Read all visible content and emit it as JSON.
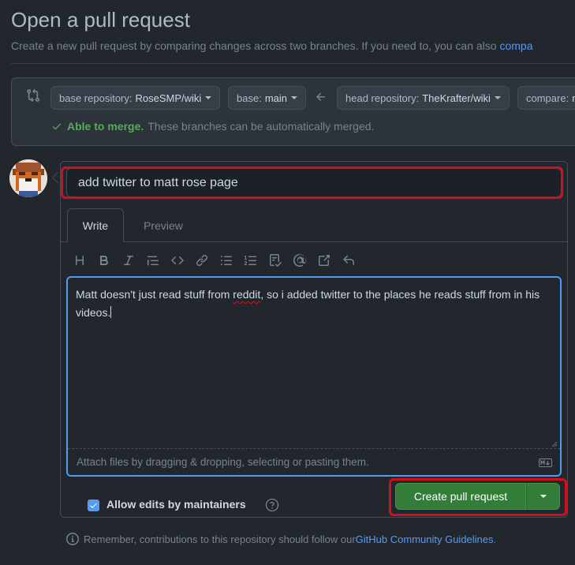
{
  "header": {
    "title": "Open a pull request",
    "subtitle_text": "Create a new pull request by comparing changes across two branches. If you need to, you can also ",
    "subtitle_link": "compa"
  },
  "range": {
    "base_repo_label": "base repository:",
    "base_repo_value": "RoseSMP/wiki",
    "base_label": "base:",
    "base_value": "main",
    "head_repo_label": "head repository:",
    "head_repo_value": "TheKrafter/wiki",
    "compare_label": "compare:",
    "compare_value": "m",
    "merge_status_bold": "Able to merge.",
    "merge_status_text": "These branches can be automatically merged."
  },
  "form": {
    "title_value": "add twitter to matt rose page",
    "tabs": [
      {
        "label": "Write"
      },
      {
        "label": "Preview"
      }
    ],
    "toolbar_icons": [
      "heading-icon",
      "bold-icon",
      "italic-icon",
      "quote-icon",
      "code-icon",
      "link-icon",
      "unordered-list-icon",
      "ordered-list-icon",
      "task-list-icon",
      "mention-icon",
      "reference-icon",
      "reply-icon"
    ],
    "body_part1": "Matt doesn't just read stuff from ",
    "body_misspelled": "reddit",
    "body_part2": ", so i added twitter to the places he reads stuff from in his videos.",
    "attach_text": "Attach files by dragging & dropping, selecting or pasting them.",
    "allow_edits_label": "Allow edits by maintainers",
    "allow_edits_checked": true,
    "create_label": "Create pull request"
  },
  "footer": {
    "note_text": "Remember, contributions to this repository should follow our ",
    "note_link": "GitHub Community Guidelines",
    "note_end": "."
  },
  "colors": {
    "background": "#22272e",
    "accent_blue": "#539bf5",
    "success_green": "#57ab5a",
    "button_green": "#347d39",
    "highlight_red": "#d0111c"
  }
}
